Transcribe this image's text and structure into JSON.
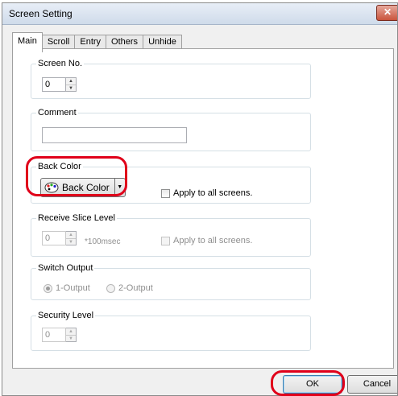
{
  "window": {
    "title": "Screen Setting",
    "close_glyph": "✕"
  },
  "tabs": [
    {
      "label": "Main",
      "active": true
    },
    {
      "label": "Scroll"
    },
    {
      "label": "Entry"
    },
    {
      "label": "Others"
    },
    {
      "label": "Unhide"
    }
  ],
  "screen_no": {
    "legend": "Screen No.",
    "value": "0"
  },
  "comment": {
    "legend": "Comment",
    "value": ""
  },
  "back_color": {
    "legend": "Back Color",
    "button_label": "Back Color",
    "apply_all_label": "Apply to all screens."
  },
  "receive_slice": {
    "legend": "Receive Slice Level",
    "value": "0",
    "unit": "*100msec",
    "apply_all_label": "Apply to all screens."
  },
  "switch_output": {
    "legend": "Switch Output",
    "option1": "1-Output",
    "option2": "2-Output",
    "selected": "1-Output"
  },
  "security_level": {
    "legend": "Security Level",
    "value": "0"
  },
  "buttons": {
    "ok": "OK",
    "cancel": "Cancel"
  },
  "colors": {
    "highlight": "#e0001a",
    "ok_focus_border": "#3c7fb1"
  }
}
